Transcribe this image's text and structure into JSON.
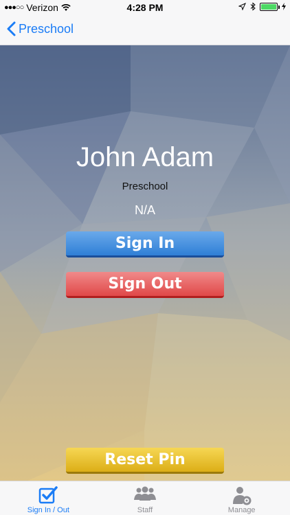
{
  "status_bar": {
    "carrier": "Verizon",
    "time": "4:28 PM"
  },
  "nav": {
    "back_label": "Preschool"
  },
  "person": {
    "name": "John Adam",
    "group": "Preschool",
    "status": "N/A"
  },
  "actions": {
    "sign_in": "Sign In",
    "sign_out": "Sign Out",
    "reset_pin": "Reset Pin"
  },
  "tabs": [
    {
      "label": "Sign In / Out",
      "icon": "checkbox-icon",
      "active": true
    },
    {
      "label": "Staff",
      "icon": "people-icon",
      "active": false
    },
    {
      "label": "Manage",
      "icon": "manage-user-icon",
      "active": false
    }
  ],
  "colors": {
    "accent": "#1a7cf6",
    "sign_in": "#3a86d9",
    "sign_out": "#e55757",
    "reset": "#e7be2a"
  }
}
